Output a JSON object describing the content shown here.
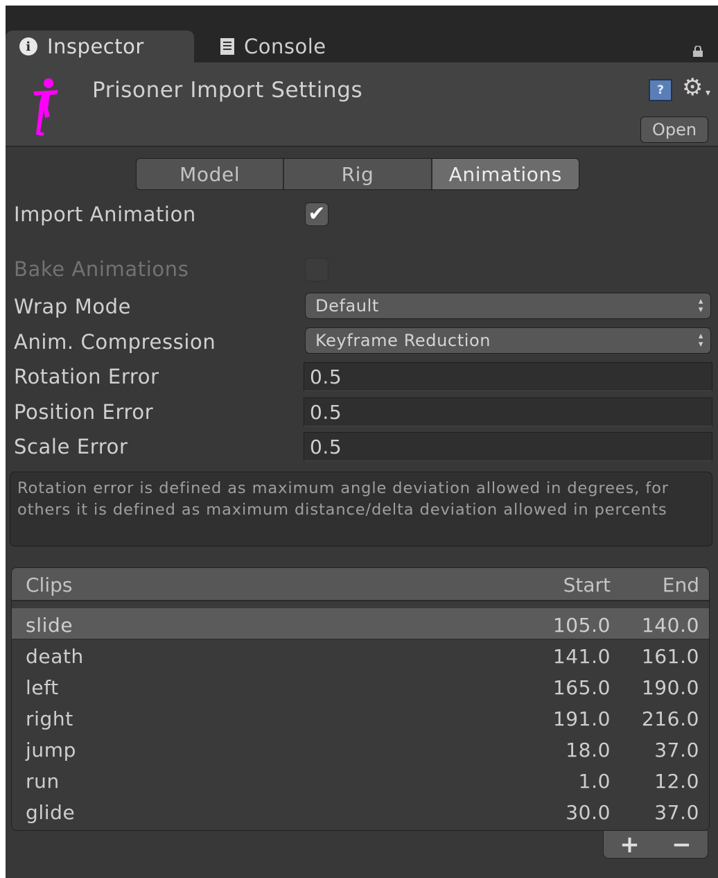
{
  "tabs_window": {
    "inspector_label": "Inspector",
    "console_label": "Console"
  },
  "header": {
    "title": "Prisoner Import Settings",
    "help_icon": "?",
    "open_label": "Open"
  },
  "section_tabs": [
    {
      "label": "Model",
      "active": false
    },
    {
      "label": "Rig",
      "active": false
    },
    {
      "label": "Animations",
      "active": true
    }
  ],
  "settings": {
    "import_animation": {
      "label": "Import Animation",
      "checked": true,
      "check_glyph": "✔"
    },
    "bake_animations": {
      "label": "Bake Animations",
      "checked": false,
      "disabled": true
    },
    "wrap_mode": {
      "label": "Wrap Mode",
      "value": "Default"
    },
    "anim_compression": {
      "label": "Anim. Compression",
      "value": "Keyframe Reduction"
    },
    "rotation_error": {
      "label": "Rotation Error",
      "value": "0.5"
    },
    "position_error": {
      "label": "Position Error",
      "value": "0.5"
    },
    "scale_error": {
      "label": "Scale Error",
      "value": "0.5"
    }
  },
  "help_text": "Rotation error is defined as maximum angle deviation allowed in degrees, for others it is defined as maximum distance/delta deviation allowed in percents",
  "clips": {
    "headers": {
      "name": "Clips",
      "start": "Start",
      "end": "End"
    },
    "rows": [
      {
        "name": "slide",
        "start": "105.0",
        "end": "140.0",
        "selected": true
      },
      {
        "name": "death",
        "start": "141.0",
        "end": "161.0"
      },
      {
        "name": "left",
        "start": "165.0",
        "end": "190.0"
      },
      {
        "name": "right",
        "start": "191.0",
        "end": "216.0"
      },
      {
        "name": "jump",
        "start": "18.0",
        "end": "37.0"
      },
      {
        "name": "run",
        "start": "1.0",
        "end": "12.0"
      },
      {
        "name": "glide",
        "start": "30.0",
        "end": "37.0"
      }
    ],
    "add_label": "+",
    "remove_label": "−"
  },
  "colors": {
    "panel_bg": "#383838",
    "active_tab": "#6c6c6c",
    "asset_icon": "#ff00ff"
  },
  "icons": [
    "info-icon",
    "console-doc-icon",
    "lock-icon",
    "humanoid-asset-icon",
    "help-icon",
    "gear-icon",
    "dropdown-arrows-icon"
  ]
}
